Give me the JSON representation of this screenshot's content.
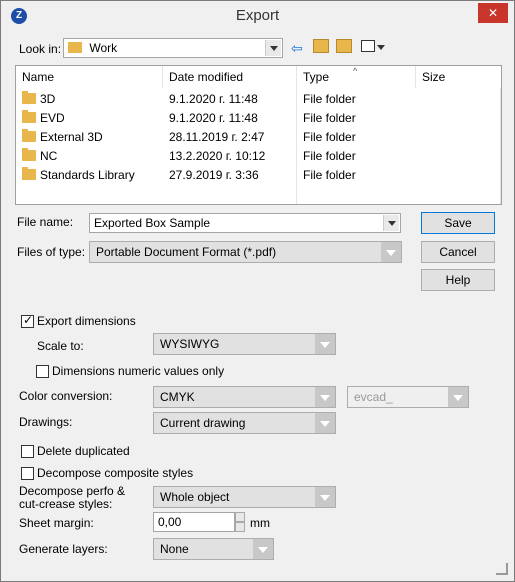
{
  "window": {
    "title": "Export"
  },
  "lookin": {
    "label": "Look in:",
    "value": "Work"
  },
  "list": {
    "columns": [
      "Name",
      "Date modified",
      "Type",
      "Size"
    ],
    "rows": [
      {
        "name": "3D",
        "date": "9.1.2020 г. 11:48",
        "type": "File folder"
      },
      {
        "name": "EVD",
        "date": "9.1.2020 г. 11:48",
        "type": "File folder"
      },
      {
        "name": "External 3D",
        "date": "28.11.2019 г. 2:47",
        "type": "File folder"
      },
      {
        "name": "NC",
        "date": "13.2.2020 г. 10:12",
        "type": "File folder"
      },
      {
        "name": "Standards Library",
        "date": "27.9.2019 г. 3:36",
        "type": "File folder"
      }
    ]
  },
  "filename": {
    "label": "File name:",
    "value": "Exported Box Sample"
  },
  "filetype": {
    "label": "Files of type:",
    "value": "Portable Document Format (*.pdf)"
  },
  "buttons": {
    "save": "Save",
    "cancel": "Cancel",
    "help": "Help"
  },
  "options": {
    "export_dimensions": "Export dimensions",
    "scale_to_label": "Scale to:",
    "scale_to_value": "WYSIWYG",
    "dim_numeric": "Dimensions numeric values only",
    "color_conv_label": "Color conversion:",
    "color_conv_value": "CMYK",
    "evcad_value": "evcad_",
    "drawings_label": "Drawings:",
    "drawings_value": "Current drawing",
    "delete_dup": "Delete duplicated",
    "decompose_comp": "Decompose composite styles",
    "decompose_perfo_label1": "Decompose perfo &",
    "decompose_perfo_label2": "cut-crease styles:",
    "decompose_perfo_value": "Whole object",
    "sheet_margin_label": "Sheet margin:",
    "sheet_margin_value": "0,00",
    "sheet_margin_unit": "mm",
    "generate_layers_label": "Generate layers:",
    "generate_layers_value": "None"
  }
}
